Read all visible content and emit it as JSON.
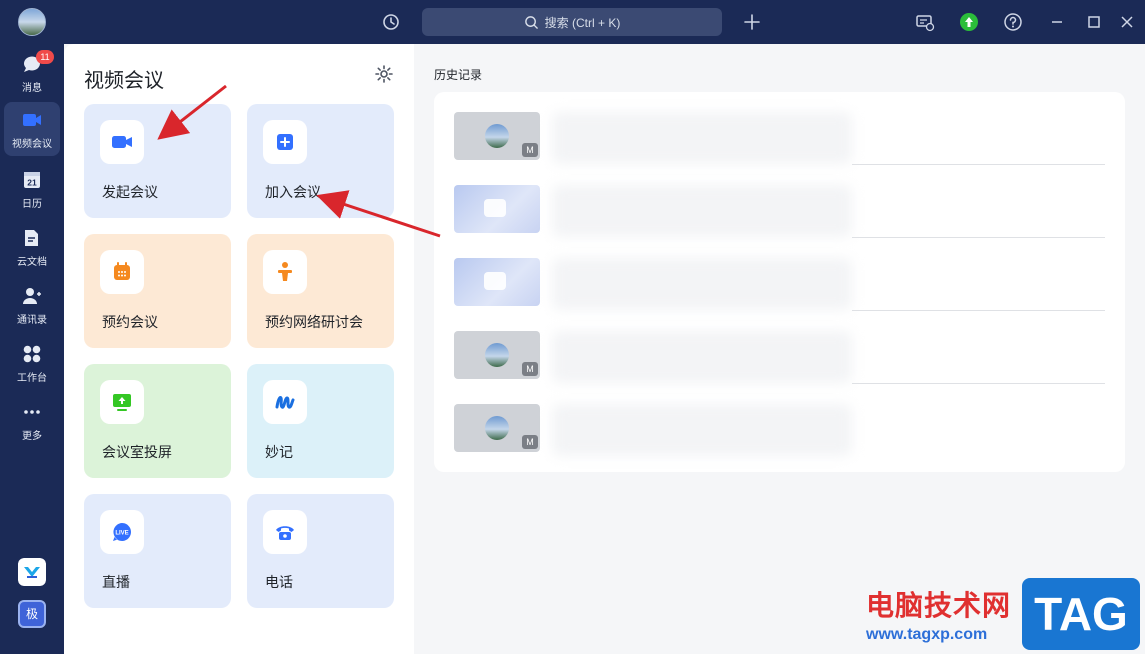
{
  "search": {
    "label": "搜索 (Ctrl + K)"
  },
  "nav": {
    "items": [
      {
        "label": "消息",
        "badge": "11"
      },
      {
        "label": "视频会议"
      },
      {
        "label": "日历"
      },
      {
        "label": "云文档"
      },
      {
        "label": "通讯录"
      },
      {
        "label": "工作台"
      },
      {
        "label": "更多"
      }
    ],
    "calendar_day": "21",
    "bottom_app_label": "极"
  },
  "panel": {
    "title": "视频会议",
    "cards": [
      {
        "label": "发起会议"
      },
      {
        "label": "加入会议"
      },
      {
        "label": "预约会议"
      },
      {
        "label": "预约网络研讨会"
      },
      {
        "label": "会议室投屏"
      },
      {
        "label": "妙记"
      },
      {
        "label": "直播"
      },
      {
        "label": "电话"
      }
    ]
  },
  "history": {
    "label": "历史记录",
    "rows": [
      {
        "thumb": "avatar",
        "mini": "M"
      },
      {
        "thumb": "camera"
      },
      {
        "thumb": "camera"
      },
      {
        "thumb": "avatar",
        "mini": "M"
      },
      {
        "thumb": "avatar",
        "mini": "M"
      }
    ]
  },
  "watermark": {
    "site": "电脑技术网",
    "url": "www.tagxp.com",
    "tag": "TAG"
  },
  "colors": {
    "nav_bg": "#1b2a56",
    "accent_blue": "#3370ff",
    "accent_orange": "#f5891f",
    "accent_green": "#34c724",
    "arrow_red": "#d9262c"
  },
  "live_badge": "LIVE"
}
